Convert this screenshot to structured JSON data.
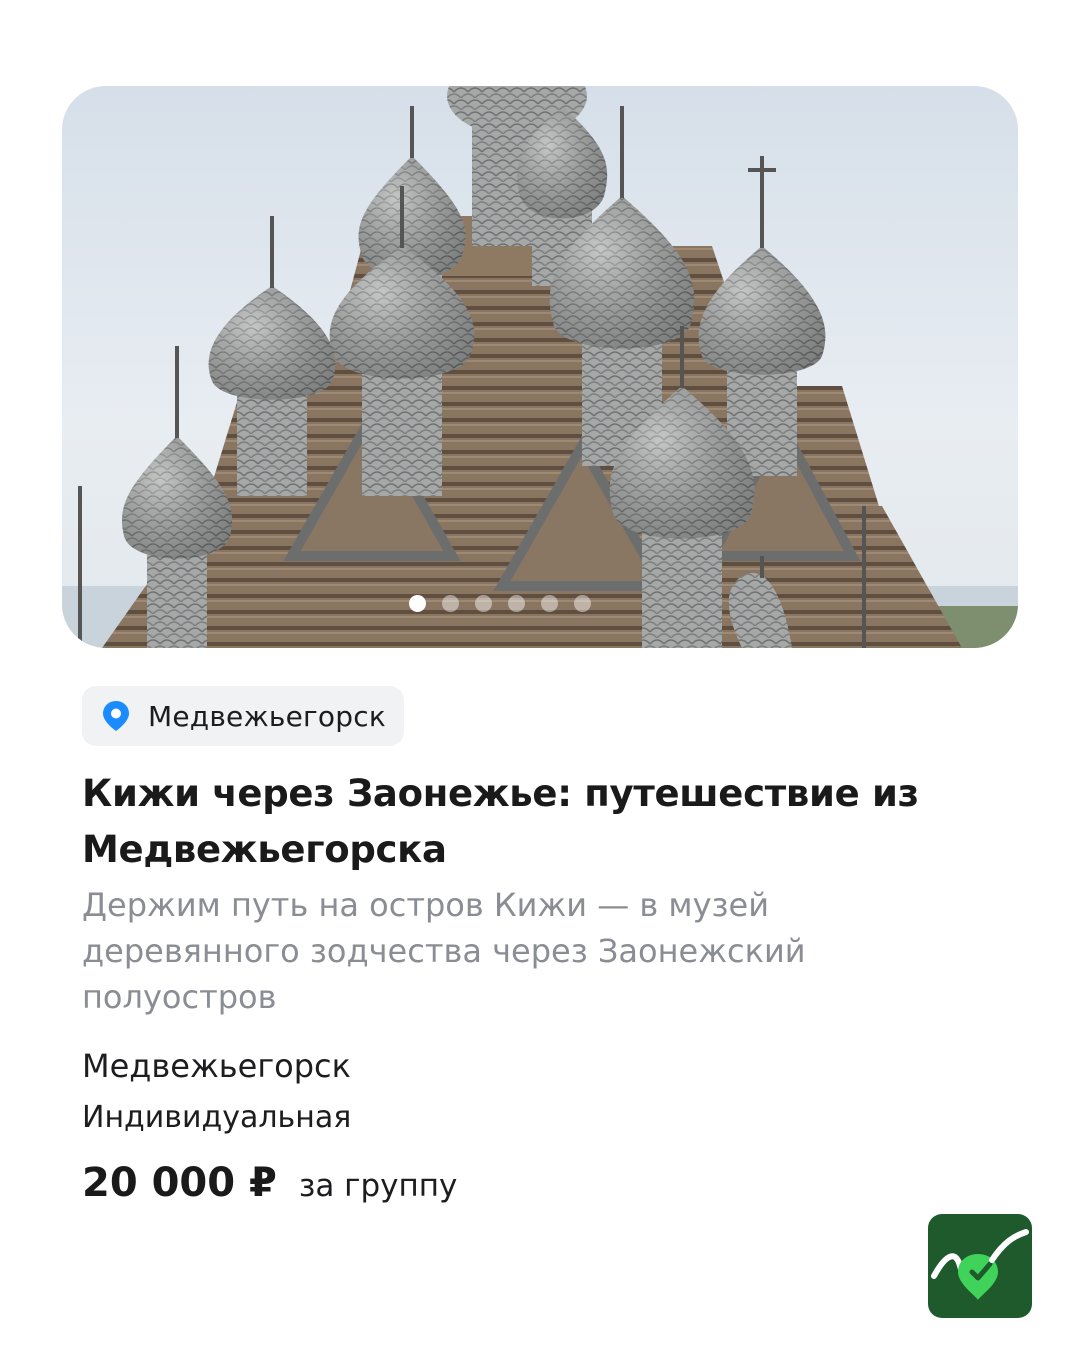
{
  "card": {
    "favorite_icon": "heart-outline-icon",
    "carousel": {
      "slide_count": 6,
      "active_index": 0
    },
    "location_chip": {
      "icon": "map-pin-icon",
      "label": "Медвежьегорск",
      "icon_color": "#1a8cff"
    },
    "title": "Кижи через Заонежье: путешествие из Медвежьегорска",
    "description": "Держим путь на остров Кижи — в музей деревянного зодчества через Заонежский полуостров",
    "city": "Медвежьегорск",
    "tour_type": "Индивидуальная",
    "price": "20 000 ₽",
    "price_unit": "за группу"
  },
  "brand": {
    "logo_icon": "app-logo-icon",
    "logo_color": "#1f5a2c",
    "accent": "#3fd35a"
  }
}
